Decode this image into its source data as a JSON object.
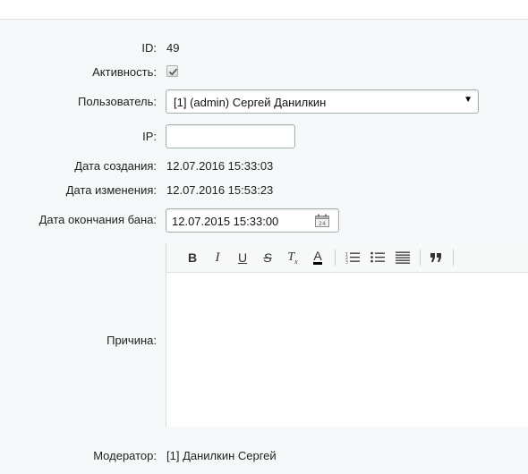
{
  "form": {
    "id_label": "ID:",
    "id_value": "49",
    "active_label": "Активность:",
    "active_checked": true,
    "user_label": "Пользователь:",
    "user_value": "[1] (admin) Сергей Данилкин",
    "ip_label": "IP:",
    "ip_value": "",
    "created_label": "Дата создания:",
    "created_value": "12.07.2016 15:33:03",
    "modified_label": "Дата изменения:",
    "modified_value": "12.07.2016 15:53:23",
    "ban_end_label": "Дата окончания бана:",
    "ban_end_value": "12.07.2015 15:33:00",
    "reason_label": "Причина:",
    "moderator_label": "Модератор:",
    "moderator_value": "[1] Данилкин Сергей"
  },
  "editor": {
    "bold": "B",
    "italic": "I",
    "underline": "U",
    "strike": "S",
    "clear_main": "T",
    "clear_sub": "x",
    "color": "A"
  },
  "colors": {
    "background": "#f5f9f9",
    "field_border": "#a6b0b2"
  }
}
